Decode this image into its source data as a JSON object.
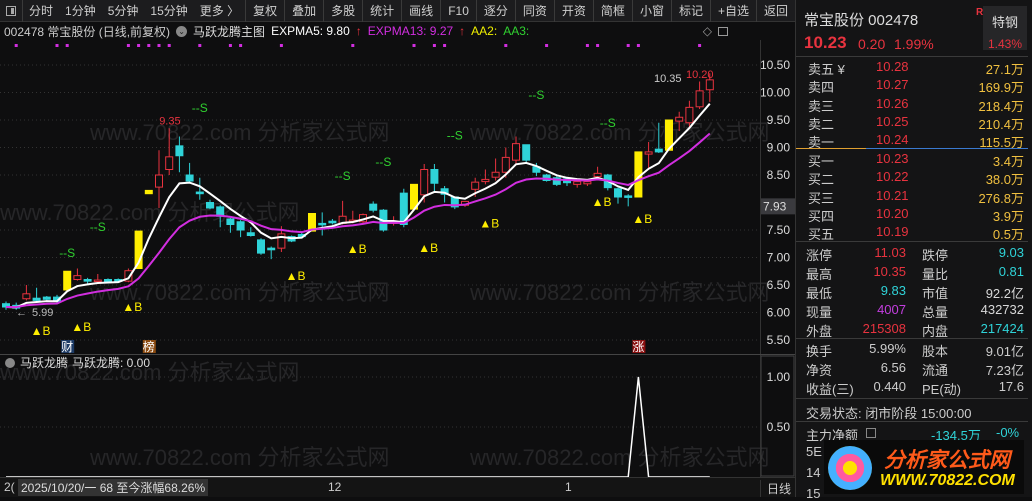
{
  "toolbar": {
    "left": [
      "分时",
      "1分钟",
      "5分钟",
      "15分钟",
      "更多 〉"
    ],
    "right": [
      "复权",
      "叠加",
      "多股",
      "统计",
      "画线",
      "F10",
      "逐分",
      "同资",
      "开资",
      "简框",
      "小窗",
      "标记",
      "+自选",
      "返回"
    ]
  },
  "info": {
    "code_name": "002478 常宝股份 (日线,前复权)",
    "formula": "马跃龙腾主图",
    "ma5": "EXPMA5: 9.80",
    "ma13": "EXPMA13: 9.27",
    "aa2": "AA2:",
    "aa3": "AA3:"
  },
  "colors": {
    "up": "#e8333f",
    "down": "#2fd3d8",
    "limit": "#ffee00",
    "ma5": "#ffffff",
    "ma13": "#d22ee0",
    "signal_s": "#30d030",
    "signal_b": "#ffee00"
  },
  "watermark": "www.70822.com 分析家公式网",
  "chart_data": {
    "type": "candlestick",
    "y_ticks": [
      "10.50",
      "10.00",
      "9.50",
      "9.00",
      "8.50",
      "7.50",
      "7.00",
      "6.50",
      "6.00",
      "5.50"
    ],
    "ylim": [
      5.5,
      10.5
    ],
    "crosshair_price": "7.93",
    "high_label": "9.35",
    "recent_high_label": "10.35",
    "last_label": "10.20",
    "low_label": "5.99",
    "candles": [
      [
        6.16,
        6.1,
        6.2,
        6.05,
        "d"
      ],
      [
        6.13,
        6.08,
        6.18,
        6.05,
        "d"
      ],
      [
        6.25,
        6.34,
        6.5,
        6.22,
        "u"
      ],
      [
        6.26,
        6.22,
        6.45,
        6.18,
        "d"
      ],
      [
        6.28,
        6.24,
        6.3,
        6.2,
        "d"
      ],
      [
        6.28,
        6.2,
        6.32,
        6.17,
        "d"
      ],
      [
        6.41,
        6.75,
        6.75,
        6.41,
        "y"
      ],
      [
        6.6,
        6.67,
        6.8,
        6.58,
        "u"
      ],
      [
        6.6,
        6.57,
        6.63,
        6.52,
        "d"
      ],
      [
        6.58,
        6.59,
        6.7,
        6.57,
        "u"
      ],
      [
        6.6,
        6.56,
        6.62,
        6.53,
        "d"
      ],
      [
        6.6,
        6.57,
        6.62,
        6.54,
        "d"
      ],
      [
        6.57,
        6.76,
        6.8,
        6.55,
        "u"
      ],
      [
        6.8,
        7.48,
        7.48,
        6.8,
        "y"
      ],
      [
        8.16,
        8.22,
        8.22,
        8.16,
        "y"
      ],
      [
        8.28,
        8.5,
        8.95,
        7.9,
        "u"
      ],
      [
        8.6,
        8.83,
        9.35,
        8.5,
        "u"
      ],
      [
        9.03,
        8.85,
        9.2,
        8.55,
        "d"
      ],
      [
        8.5,
        8.39,
        8.72,
        8.35,
        "d"
      ],
      [
        8.19,
        8.16,
        8.45,
        8.05,
        "d"
      ],
      [
        8.0,
        7.9,
        8.05,
        7.88,
        "d"
      ],
      [
        7.92,
        7.75,
        7.95,
        7.55,
        "d"
      ],
      [
        7.7,
        7.6,
        7.72,
        7.45,
        "d"
      ],
      [
        7.65,
        7.5,
        7.68,
        7.37,
        "d"
      ],
      [
        7.45,
        7.4,
        7.55,
        7.38,
        "d"
      ],
      [
        7.32,
        7.08,
        7.35,
        7.05,
        "d"
      ],
      [
        7.17,
        7.14,
        7.2,
        6.97,
        "d"
      ],
      [
        7.17,
        7.43,
        7.57,
        7.1,
        "u"
      ],
      [
        7.38,
        7.3,
        7.4,
        7.28,
        "d"
      ],
      [
        7.42,
        7.38,
        7.48,
        7.36,
        "d"
      ],
      [
        7.48,
        7.8,
        7.8,
        7.48,
        "y"
      ],
      [
        7.62,
        7.6,
        7.82,
        7.4,
        "d"
      ],
      [
        7.66,
        7.63,
        7.7,
        7.6,
        "d"
      ],
      [
        7.62,
        7.75,
        8.03,
        7.6,
        "u"
      ],
      [
        7.66,
        7.68,
        7.85,
        7.62,
        "u"
      ],
      [
        7.65,
        7.78,
        7.8,
        7.62,
        "u"
      ],
      [
        7.97,
        7.86,
        8.02,
        7.82,
        "d"
      ],
      [
        7.86,
        7.5,
        7.88,
        7.47,
        "d"
      ],
      [
        7.62,
        7.66,
        7.75,
        7.58,
        "u"
      ],
      [
        8.17,
        7.6,
        8.25,
        7.55,
        "d"
      ],
      [
        7.88,
        8.33,
        8.33,
        7.88,
        "y"
      ],
      [
        8.14,
        8.6,
        8.7,
        8.0,
        "u"
      ],
      [
        8.6,
        8.35,
        8.7,
        8.2,
        "d"
      ],
      [
        8.25,
        8.15,
        8.3,
        8.0,
        "d"
      ],
      [
        8.1,
        7.92,
        8.1,
        7.88,
        "d"
      ],
      [
        7.95,
        8.02,
        8.03,
        7.92,
        "u"
      ],
      [
        8.24,
        8.37,
        8.45,
        8.1,
        "u"
      ],
      [
        8.38,
        8.42,
        8.6,
        8.33,
        "u"
      ],
      [
        8.46,
        8.55,
        8.8,
        8.4,
        "u"
      ],
      [
        8.55,
        8.82,
        9.0,
        8.45,
        "u"
      ],
      [
        8.77,
        9.07,
        9.2,
        8.7,
        "u"
      ],
      [
        9.05,
        8.77,
        9.05,
        8.7,
        "d"
      ],
      [
        8.65,
        8.55,
        8.72,
        8.48,
        "d"
      ],
      [
        8.5,
        8.4,
        8.52,
        8.38,
        "d"
      ],
      [
        8.45,
        8.33,
        8.5,
        8.3,
        "d"
      ],
      [
        8.43,
        8.36,
        8.46,
        8.3,
        "d"
      ],
      [
        8.33,
        8.38,
        8.42,
        8.27,
        "u"
      ],
      [
        8.34,
        8.38,
        8.42,
        8.3,
        "u"
      ],
      [
        8.47,
        8.53,
        8.65,
        8.4,
        "u"
      ],
      [
        8.5,
        8.27,
        8.52,
        8.22,
        "d"
      ],
      [
        8.25,
        8.1,
        8.27,
        7.98,
        "d"
      ],
      [
        8.12,
        8.1,
        8.15,
        7.93,
        "d"
      ],
      [
        8.1,
        8.92,
        8.92,
        8.1,
        "y"
      ],
      [
        8.88,
        8.92,
        9.1,
        8.6,
        "u"
      ],
      [
        8.97,
        8.92,
        9.45,
        8.9,
        "d"
      ],
      [
        8.95,
        9.5,
        9.5,
        8.95,
        "y"
      ],
      [
        9.48,
        9.55,
        9.65,
        9.3,
        "u"
      ],
      [
        9.45,
        9.73,
        9.85,
        9.35,
        "u"
      ],
      [
        9.74,
        10.03,
        10.2,
        9.7,
        "u"
      ],
      [
        10.05,
        10.23,
        10.35,
        9.83,
        "u"
      ]
    ],
    "s_signals": [
      [
        6,
        7.01
      ],
      [
        9,
        7.48
      ],
      [
        19,
        9.65
      ],
      [
        33,
        8.41
      ],
      [
        37,
        8.66
      ],
      [
        44,
        9.15
      ],
      [
        52,
        9.88
      ],
      [
        59,
        9.37
      ]
    ],
    "b_signals": [
      [
        3,
        5.59
      ],
      [
        7,
        5.66
      ],
      [
        12,
        6.03
      ],
      [
        28,
        6.59
      ],
      [
        34,
        7.08
      ],
      [
        41,
        7.1
      ],
      [
        47,
        7.55
      ],
      [
        58,
        7.94
      ],
      [
        62,
        7.63
      ]
    ],
    "s_label": "--S",
    "b_label": "▲B",
    "top_dots": [
      1,
      5,
      6,
      12,
      13,
      14,
      15,
      16,
      19,
      22,
      23,
      27,
      34,
      40,
      42,
      43,
      49,
      53,
      57,
      58,
      61,
      62,
      68
    ],
    "events": [
      {
        "i": 6,
        "text": "财",
        "color": "#1d3b66"
      },
      {
        "i": 14,
        "text": "榜",
        "color": "#8a4a10"
      },
      {
        "i": 62,
        "text": "涨",
        "color": "#8a1010"
      }
    ],
    "indicator": {
      "name": "马跃龙腾",
      "label": "马跃龙腾: 0.00",
      "y_ticks": [
        "1.00",
        "0.50"
      ],
      "ylim": [
        0,
        1
      ],
      "spike_index": 62,
      "spike_value": 1
    }
  },
  "bottom": {
    "clip": "2(",
    "date_info": "2025/10/20/一 68 至今涨幅68.26%",
    "month1": "12",
    "month2": "1",
    "period": "日线"
  },
  "quote": {
    "name": "常宝股份 002478",
    "r_badge": "R",
    "sector": "特钢",
    "sector_pct": "1.43%",
    "price": "10.23",
    "change": "0.20",
    "pct": "1.99%",
    "asks": [
      {
        "l": "卖五 ¥",
        "p": "10.28",
        "v": "27.1万"
      },
      {
        "l": "卖四",
        "p": "10.27",
        "v": "169.9万"
      },
      {
        "l": "卖三",
        "p": "10.26",
        "v": "218.4万"
      },
      {
        "l": "卖二",
        "p": "10.25",
        "v": "210.4万"
      },
      {
        "l": "卖一",
        "p": "10.24",
        "v": "115.5万"
      }
    ],
    "bids": [
      {
        "l": "买一",
        "p": "10.23",
        "v": "3.4万"
      },
      {
        "l": "买二",
        "p": "10.22",
        "v": "38.0万"
      },
      {
        "l": "买三",
        "p": "10.21",
        "v": "276.8万"
      },
      {
        "l": "买四",
        "p": "10.20",
        "v": "3.9万"
      },
      {
        "l": "买五",
        "p": "10.19",
        "v": "0.5万"
      }
    ],
    "stats": [
      [
        "涨停",
        "11.03",
        "red",
        "跌停",
        "9.03",
        "cyan"
      ],
      [
        "最高",
        "10.35",
        "red",
        "量比",
        "0.81",
        "cyan"
      ],
      [
        "最低",
        "9.83",
        "cyan",
        "市值",
        "92.2亿",
        "wht"
      ],
      [
        "现量",
        "4007",
        "mag",
        "总量",
        "432732",
        "wht"
      ],
      [
        "外盘",
        "215308",
        "red",
        "内盘",
        "217424",
        "cyan"
      ]
    ],
    "stats2": [
      [
        "换手",
        "5.99%",
        "股本",
        "9.01亿"
      ],
      [
        "净资",
        "6.56",
        "流通",
        "7.23亿"
      ],
      [
        "收益(三)",
        "0.440",
        "PE(动)",
        "17.6"
      ]
    ],
    "status": "交易状态: 闭市阶段 15:00:00",
    "flow_label": "主力净额",
    "flow_value": "-134.5万",
    "flow_pct": "-0%",
    "hidden_rows": [
      "5E",
      "14",
      "15"
    ],
    "logo_cn": "分析家公式网",
    "logo_url": "WWW.70822.COM"
  }
}
